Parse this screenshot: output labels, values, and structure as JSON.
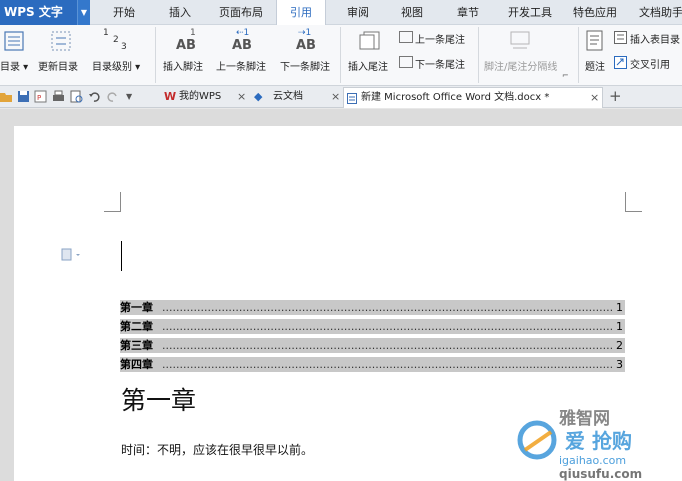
{
  "app": {
    "name": "WPS 文字"
  },
  "menu_tabs": [
    "开始",
    "插入",
    "页面布局",
    "引用",
    "审阅",
    "视图",
    "章节",
    "开发工具",
    "特色应用",
    "文档助手"
  ],
  "active_menu_tab": "引用",
  "ribbon": {
    "toc": "目录",
    "update_toc": "更新目录",
    "toc_level": "目录级别",
    "insert_footnote": "插入脚注",
    "prev_footnote": "上一条脚注",
    "next_footnote": "下一条脚注",
    "insert_endnote": "插入尾注",
    "prev_endnote": "上一条尾注",
    "next_endnote": "下一条尾注",
    "footnote_separator": "脚注/尾注分隔线",
    "caption": "题注",
    "insert_table_of_figures": "插入表目录",
    "cross_reference": "交叉引用"
  },
  "doc_tabs": [
    {
      "label": "我的WPS",
      "close": "×"
    },
    {
      "label": "云文档",
      "close": "×"
    },
    {
      "label": "新建 Microsoft Office Word 文档.docx *",
      "close": "×"
    }
  ],
  "new_tab": "+",
  "toc_entries": [
    {
      "title": "第一章",
      "page": "1"
    },
    {
      "title": "第二章",
      "page": "1"
    },
    {
      "title": "第三章",
      "page": "2"
    },
    {
      "title": "第四章",
      "page": "3"
    }
  ],
  "document": {
    "heading": "第一章",
    "body": "时间：不明，应该在很早很早以前。"
  },
  "watermark": {
    "brand": "雅智网",
    "site1": "igaihao.com",
    "site2": "qiusufu.com"
  },
  "colors": {
    "accent": "#2b6bbf",
    "toc_highlight": "#c8c8c8"
  }
}
